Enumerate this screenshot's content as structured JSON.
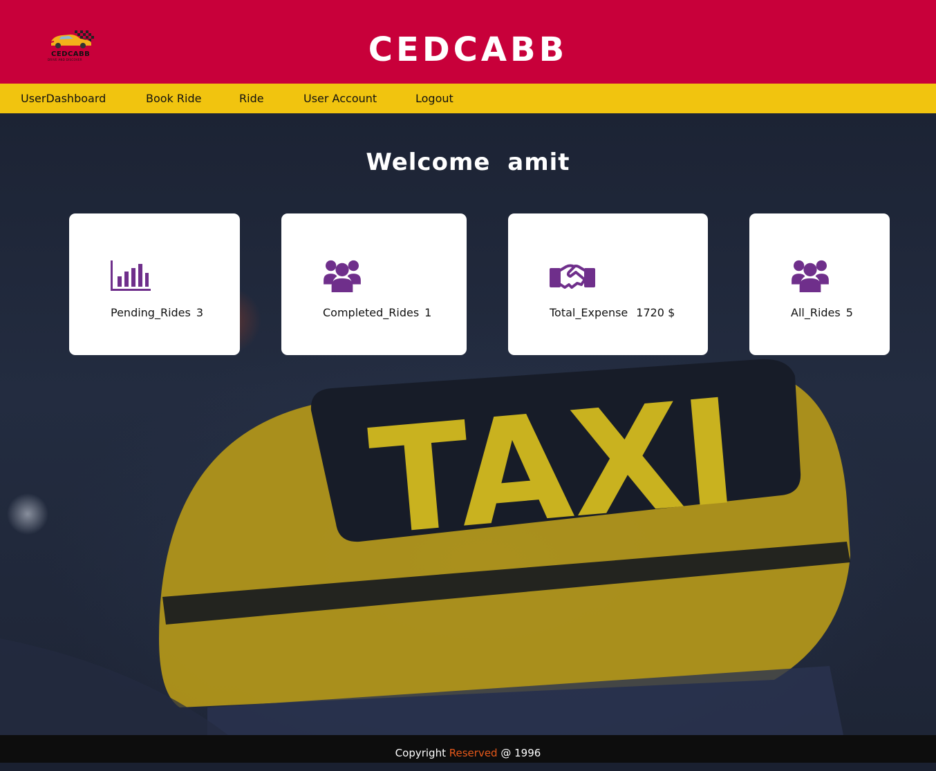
{
  "header": {
    "logo_text": "CEDCABB",
    "logo_tagline": "DRIVE AND DISCOVER",
    "title": "CEDCABB"
  },
  "nav": {
    "items": [
      {
        "label": "UserDashboard"
      },
      {
        "label": "Book Ride"
      },
      {
        "label": "Ride"
      },
      {
        "label": "User Account"
      },
      {
        "label": "Logout"
      }
    ]
  },
  "welcome": {
    "greeting": "Welcome",
    "username": "amit"
  },
  "cards": [
    {
      "icon": "bar-chart-icon",
      "label": "Pending_Rides",
      "value": "3"
    },
    {
      "icon": "users-icon",
      "label": "Completed_Rides",
      "value": "1"
    },
    {
      "icon": "handshake-icon",
      "label": "Total_Expense",
      "value": "1720 $"
    },
    {
      "icon": "users-icon",
      "label": "All_Rides",
      "value": "5"
    }
  ],
  "background": {
    "sign_text": "TAXI"
  },
  "footer": {
    "prefix": "Copyright",
    "accent": "Reserved",
    "suffix": "@ 1996"
  },
  "colors": {
    "header_bg": "#c8003a",
    "nav_bg": "#f1c40f",
    "icon_purple": "#6f2f8b",
    "footer_accent": "#e8591a"
  }
}
